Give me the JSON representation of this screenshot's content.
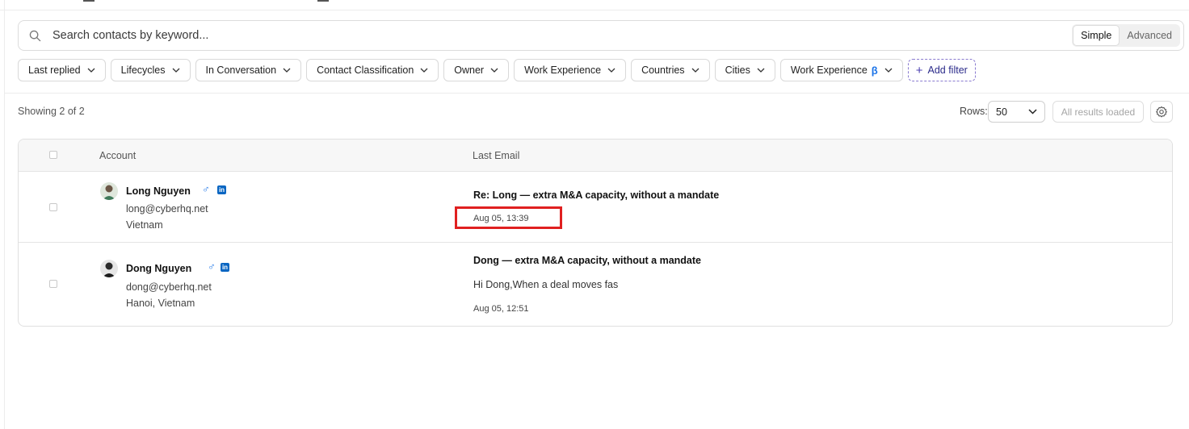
{
  "search": {
    "placeholder": "Search contacts by keyword...",
    "mode_simple": "Simple",
    "mode_advanced": "Advanced",
    "active_mode": "Simple"
  },
  "filters": [
    {
      "label": "Last replied"
    },
    {
      "label": "Lifecycles"
    },
    {
      "label": "In Conversation"
    },
    {
      "label": "Contact Classification"
    },
    {
      "label": "Owner"
    },
    {
      "label": "Work Experience"
    },
    {
      "label": "Countries"
    },
    {
      "label": "Cities"
    },
    {
      "label": "Work Experience",
      "badge": "β"
    }
  ],
  "add_filter_label": "Add filter",
  "results": {
    "showing": "Showing 2 of 2",
    "rows_label": "Rows:",
    "rows_value": "50",
    "loaded_label": "All results loaded"
  },
  "table": {
    "headers": {
      "account": "Account",
      "last_email": "Last Email"
    },
    "rows": [
      {
        "name": "Long Nguyen",
        "email": "long@cyberhq.net",
        "location": "Vietnam",
        "subject": "Re: Long — extra M&A capacity, without a mandate",
        "date": "Aug 05, 13:39"
      },
      {
        "name": "Dong Nguyen",
        "email": "dong@cyberhq.net",
        "location": "Hanoi, Vietnam",
        "subject": "Dong — extra M&A capacity, without a mandate",
        "preview": "Hi Dong,When a deal moves fas",
        "date": "Aug 05, 12:51"
      }
    ]
  },
  "icons": {
    "gender": "male-icon",
    "social": "linkedin-icon",
    "linkedin_glyph": "in",
    "linkedin_color": "#0a66c2",
    "gender_color": "#2b7de9"
  },
  "annotation_color": "#e02020"
}
